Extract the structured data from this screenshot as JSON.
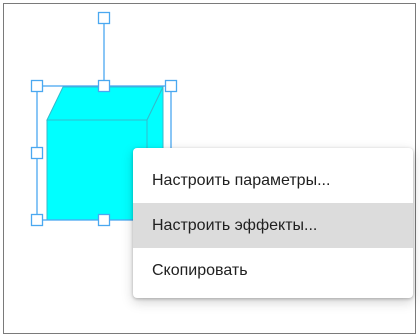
{
  "colors": {
    "cube_fill": "#00FFFF",
    "cube_edge": "#33BBCC",
    "selection": "#4AA8F0",
    "menu_highlight": "#DCDCDC"
  },
  "context_menu": {
    "items": [
      {
        "label": "Настроить параметры...",
        "highlighted": false
      },
      {
        "label": "Настроить эффекты...",
        "highlighted": true
      },
      {
        "label": "Скопировать",
        "highlighted": false
      }
    ]
  }
}
